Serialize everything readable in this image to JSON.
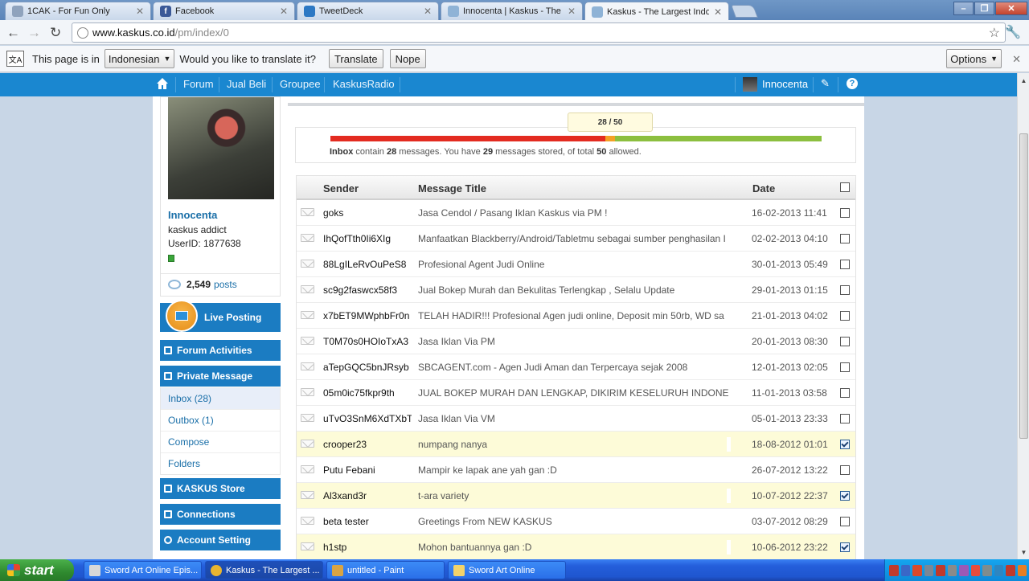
{
  "browser": {
    "tabs": [
      {
        "label": "1CAK - For Fun Only",
        "color": "#8fa3bd"
      },
      {
        "label": "Facebook",
        "color": "#3b5998"
      },
      {
        "label": "TweetDeck",
        "color": "#2c78c4"
      },
      {
        "label": "Innocenta | Kaskus - The Larg",
        "color": "#8fb3d6"
      },
      {
        "label": "Kaskus - The Largest Indones",
        "color": "#8fb3d6"
      }
    ],
    "url_host": "www.kaskus.co.id",
    "url_path": "/pm/index/0"
  },
  "translate": {
    "prefix": "This page is in",
    "language": "Indonesian",
    "question": "Would you like to translate it?",
    "translate_label": "Translate",
    "nope_label": "Nope",
    "options_label": "Options"
  },
  "kaskus_nav": {
    "items": [
      "Forum",
      "Jual Beli",
      "Groupee",
      "KaskusRadio"
    ],
    "username": "Innocenta"
  },
  "profile": {
    "name": "Innocenta",
    "rank": "kaskus addict",
    "user_id": "UserID: 1877638",
    "post_count": "2,549",
    "posts_label": "posts"
  },
  "sidebar": {
    "live_posting": "Live Posting",
    "forum_activities": "Forum Activities",
    "private_message": "Private Message",
    "pm_items": [
      "Inbox (28)",
      "Outbox (1)",
      "Compose",
      "Folders"
    ],
    "store": "KASKUS Store",
    "connections": "Connections",
    "account_setting": "Account Setting"
  },
  "quota": {
    "tooltip": "28 / 50",
    "used": 28,
    "stored": 29,
    "total": 50,
    "inbox_label": "Inbox",
    "text_contain": "contain",
    "inbox_count": "28",
    "text_messages": "messages. You have",
    "stored_count": "29",
    "text_stored": "messages stored, of total",
    "total_count": "50",
    "text_allowed": "allowed."
  },
  "table": {
    "headers": {
      "sender": "Sender",
      "title": "Message Title",
      "date": "Date"
    },
    "rows": [
      {
        "sender": "goks",
        "title": "Jasa Cendol / Pasang Iklan Kaskus via PM !",
        "date": "16-02-2013 11:41",
        "checked": false
      },
      {
        "sender": "IhQofTth0Ii6XIg",
        "title": "Manfaatkan Blackberry/Android/Tabletmu sebagai sumber penghasilan I",
        "date": "02-02-2013 04:10",
        "checked": false
      },
      {
        "sender": "88LgILeRvOuPeS8",
        "title": "Profesional Agent Judi Online",
        "date": "30-01-2013 05:49",
        "checked": false
      },
      {
        "sender": "sc9g2faswcx58f3",
        "title": "Jual Bokep Murah dan Bekulitas Terlengkap , Selalu Update",
        "date": "29-01-2013 01:15",
        "checked": false
      },
      {
        "sender": "x7bET9MWphbFr0n",
        "title": "TELAH HADIR!!! Profesional Agen judi online, Deposit min 50rb, WD sa",
        "date": "21-01-2013 04:02",
        "checked": false
      },
      {
        "sender": "T0M70s0HOIoTxA3",
        "title": "Jasa Iklan Via PM",
        "date": "20-01-2013 08:30",
        "checked": false
      },
      {
        "sender": "aTepGQC5bnJRsyb",
        "title": "SBCAGENT.com - Agen Judi Aman dan Terpercaya sejak 2008",
        "date": "12-01-2013 02:05",
        "checked": false
      },
      {
        "sender": "05m0ic75fkpr9th",
        "title": "JUAL BOKEP MURAH DAN LENGKAP, DIKIRIM KESELURUH INDONE",
        "date": "11-01-2013 03:58",
        "checked": false
      },
      {
        "sender": "uTvO3SnM6XdTXbT",
        "title": "Jasa Iklan Via VM",
        "date": "05-01-2013 23:33",
        "checked": false
      },
      {
        "sender": "crooper23",
        "title": "numpang nanya",
        "date": "18-08-2012 01:01",
        "checked": true
      },
      {
        "sender": "Putu Febani",
        "title": "Mampir ke lapak ane yah gan :D",
        "date": "26-07-2012 13:22",
        "checked": false
      },
      {
        "sender": "Al3xand3r",
        "title": "t-ara variety",
        "date": "10-07-2012 22:37",
        "checked": true
      },
      {
        "sender": "beta tester",
        "title": "Greetings From NEW KASKUS",
        "date": "03-07-2012 08:29",
        "checked": false
      },
      {
        "sender": "h1stp",
        "title": "Mohon bantuannya gan :D",
        "date": "10-06-2012 23:22",
        "checked": true
      }
    ]
  },
  "taskbar": {
    "start_label": "start",
    "items": [
      {
        "label": "Sword Art Online Epis...",
        "color": "#d8d8d8",
        "active": false
      },
      {
        "label": "Kaskus - The Largest ...",
        "color": "#e8b530",
        "active": true
      },
      {
        "label": "untitled - Paint",
        "color": "#d9a444",
        "active": false
      },
      {
        "label": "Sword Art Online",
        "color": "#f2d36a",
        "active": false
      }
    ],
    "tray_colors": [
      "#c03a2b",
      "#3a67c7",
      "#d94a2b",
      "#7a8796",
      "#c0392b",
      "#8a8a8a",
      "#9b59b6",
      "#e74c3c",
      "#7f8c8d",
      "#2e86c1",
      "#c0392b",
      "#e67e22"
    ]
  }
}
